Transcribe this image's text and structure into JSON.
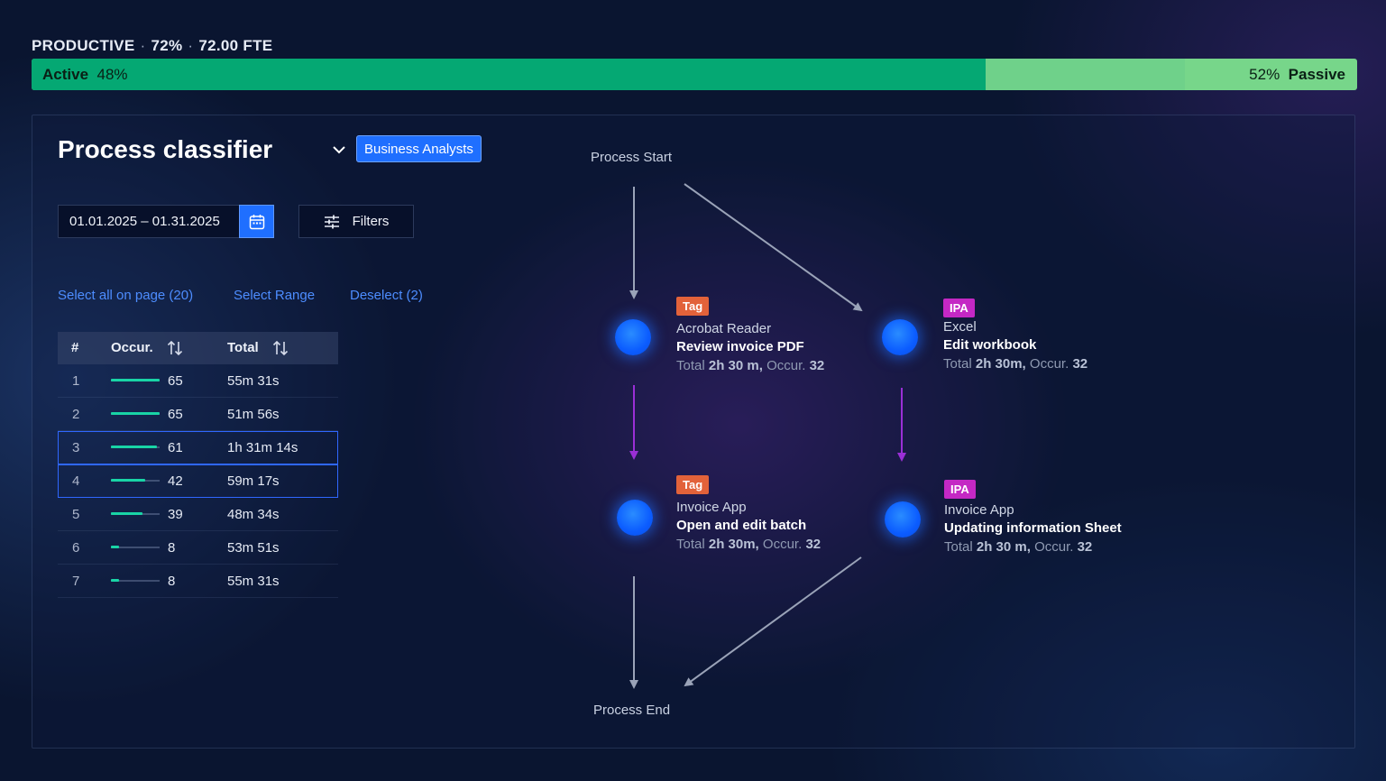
{
  "summary": {
    "category": "PRODUCTIVE",
    "percent": "72%",
    "fte": "72.00 FTE"
  },
  "activity_bar": {
    "active_label": "Active",
    "active_percent": "48%",
    "passive_label": "Passive",
    "passive_percent": "52%",
    "active_fraction": 0.72,
    "passive_split_fraction": 0.87,
    "colors": {
      "active": "#05a873",
      "passive_mid": "#6fd18a",
      "passive": "#77d68a"
    }
  },
  "header": {
    "title": "Process classifier",
    "team_badge": "Business Analysts"
  },
  "controls": {
    "date_range": "01.01.2025 – 01.31.2025",
    "filters_label": "Filters"
  },
  "selection": {
    "select_all": "Select all on page (20)",
    "select_range": "Select Range",
    "deselect": "Deselect (2)"
  },
  "table": {
    "headers": {
      "index": "#",
      "occurrences": "Occur.",
      "total": "Total"
    },
    "rows": [
      {
        "index": "1",
        "occ": "65",
        "total": "55m 31s",
        "share": 1.0,
        "selected": false
      },
      {
        "index": "2",
        "occ": "65",
        "total": "51m 56s",
        "share": 1.0,
        "selected": false
      },
      {
        "index": "3",
        "occ": "61",
        "total": "1h 31m 14s",
        "share": 0.94,
        "selected": true
      },
      {
        "index": "4",
        "occ": "42",
        "total": "59m 17s",
        "share": 0.7,
        "selected": true
      },
      {
        "index": "5",
        "occ": "39",
        "total": "48m 34s",
        "share": 0.65,
        "selected": false
      },
      {
        "index": "6",
        "occ": "8",
        "total": "53m 51s",
        "share": 0.16,
        "selected": false
      },
      {
        "index": "7",
        "occ": "8",
        "total": "55m 31s",
        "share": 0.16,
        "selected": false
      }
    ]
  },
  "flow": {
    "start_label": "Process Start",
    "end_label": "Process End",
    "nodes": [
      {
        "badge": "Tag",
        "app": "Acrobat Reader",
        "task": "Review invoice PDF",
        "total_prefix": "Total",
        "total": "2h 30 m,",
        "occ_prefix": "Occur.",
        "occ": "32"
      },
      {
        "badge": "IPA",
        "app": "Excel",
        "task": "Edit workbook",
        "total_prefix": "Total",
        "total": "2h 30m,",
        "occ_prefix": "Occur.",
        "occ": "32"
      },
      {
        "badge": "Tag",
        "app": "Invoice App",
        "task": "Open and edit batch",
        "total_prefix": "Total",
        "total": "2h 30m,",
        "occ_prefix": "Occur.",
        "occ": "32"
      },
      {
        "badge": "IPA",
        "app": "Invoice App",
        "task": "Updating information Sheet",
        "total_prefix": "Total",
        "total": "2h 30 m,",
        "occ_prefix": "Occur.",
        "occ": "32"
      }
    ]
  },
  "icons": {
    "dropdown": "chevron-down-icon",
    "calendar": "calendar-icon",
    "filters": "sliders-icon",
    "sort": "sort-arrows-icon"
  }
}
